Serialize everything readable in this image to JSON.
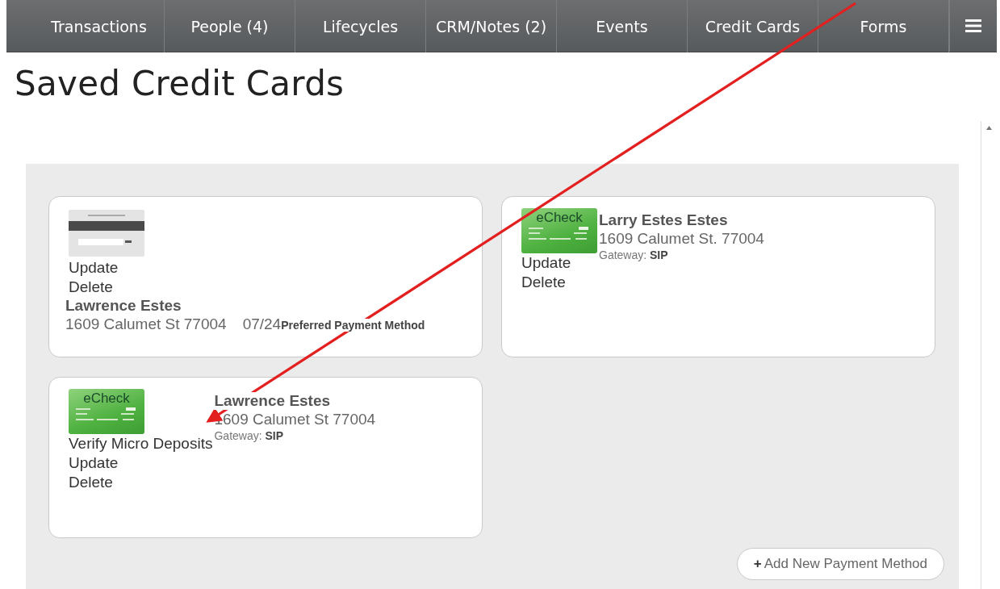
{
  "nav": {
    "tabs": [
      {
        "label": "Transactions",
        "selected": false
      },
      {
        "label": "People (4)",
        "selected": false
      },
      {
        "label": "Lifecycles",
        "selected": false
      },
      {
        "label": "CRM/Notes (2)",
        "selected": false
      },
      {
        "label": "Events",
        "selected": false
      },
      {
        "label": "Credit Cards",
        "selected": false
      },
      {
        "label": "Forms",
        "selected": false
      }
    ]
  },
  "page_title": "Saved Credit Cards",
  "payment_methods": [
    {
      "kind": "card",
      "actions": [
        "Update",
        "Delete"
      ],
      "name": "Lawrence Estes",
      "address": "1609 Calumet St 77004",
      "expiry": "07/24",
      "note": "Preferred Payment Method"
    },
    {
      "kind": "echeck",
      "image_label": "eCheck",
      "actions": [
        "Update",
        "Delete"
      ],
      "name": "Larry Estes Estes",
      "address": "1609 Calumet St. 77004",
      "gateway_label": "Gateway:",
      "gateway": "SIP"
    },
    {
      "kind": "echeck",
      "image_label": "eCheck",
      "actions": [
        "Verify Micro Deposits",
        "Update",
        "Delete"
      ],
      "name": "Lawrence Estes",
      "address": "1609 Calumet St 77004",
      "gateway_label": "Gateway:",
      "gateway": "SIP"
    }
  ],
  "add_button": {
    "icon": "+",
    "label": "Add New Payment Method"
  }
}
